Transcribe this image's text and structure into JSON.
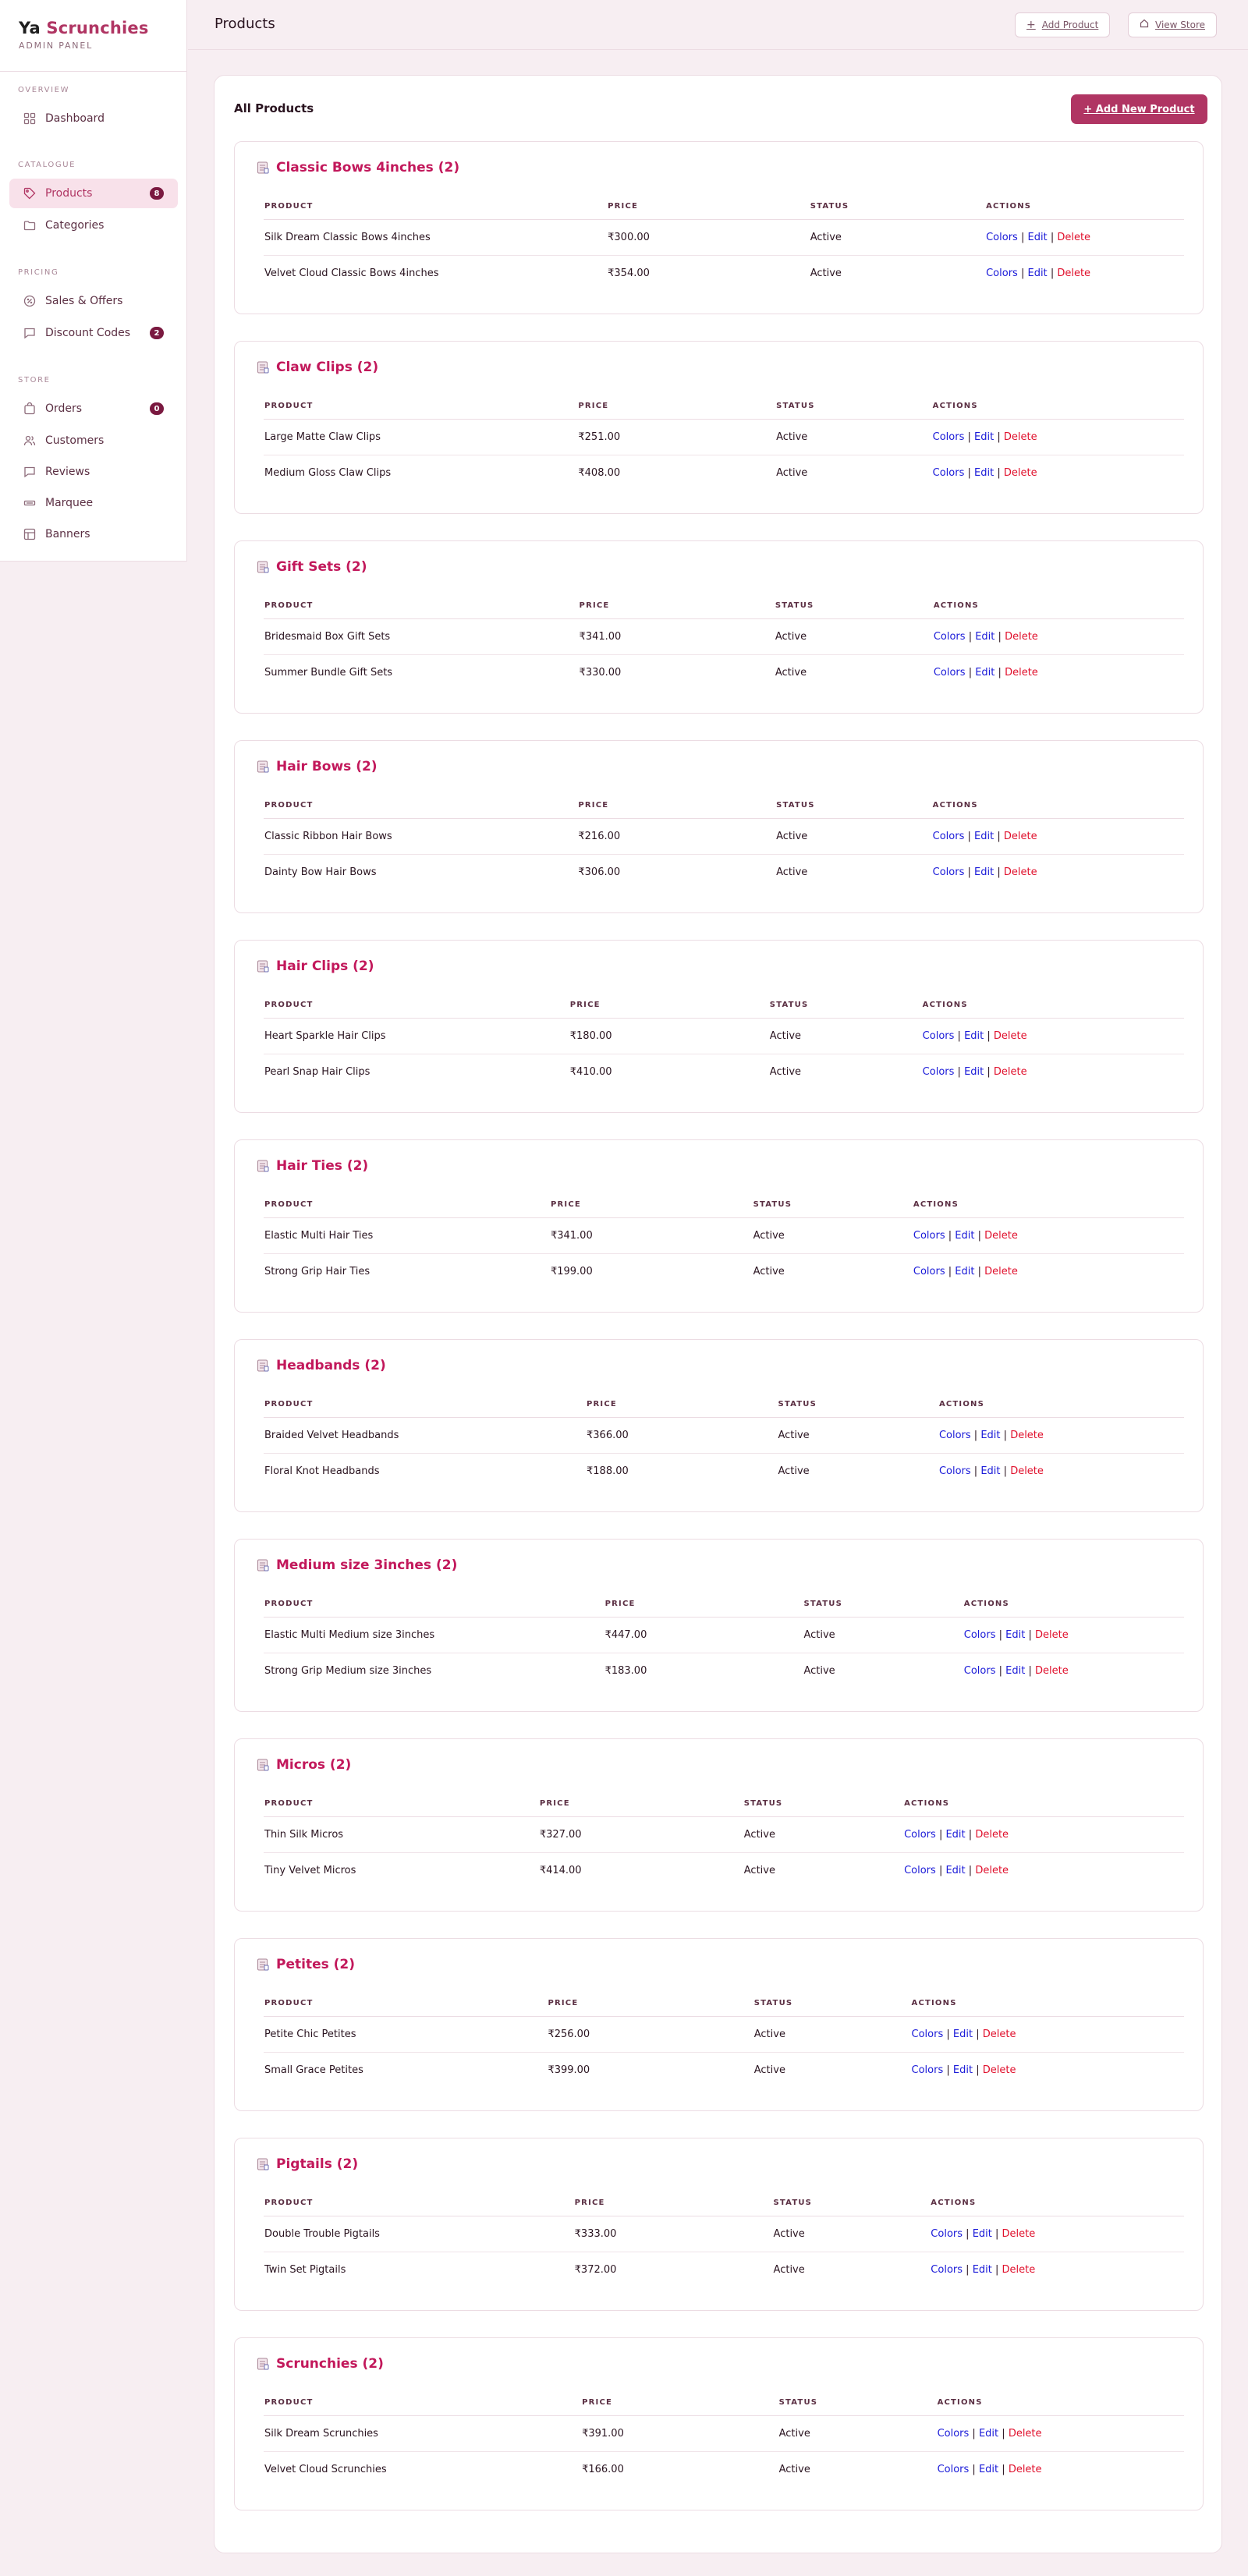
{
  "brand": {
    "name_part1": "Ya",
    "name_part2": "Scrunchies",
    "subtitle": "ADMIN PANEL"
  },
  "sidebar": {
    "sections": [
      {
        "label": "OVERVIEW",
        "items": [
          {
            "label": "Dashboard",
            "icon": "grid-icon"
          }
        ]
      },
      {
        "label": "CATALOGUE",
        "items": [
          {
            "label": "Products",
            "icon": "tag-icon",
            "badge": "8",
            "active": true
          },
          {
            "label": "Categories",
            "icon": "folder-icon"
          }
        ]
      },
      {
        "label": "PRICING",
        "items": [
          {
            "label": "Sales & Offers",
            "icon": "percent-icon"
          },
          {
            "label": "Discount Codes",
            "icon": "chat-icon",
            "badge": "2"
          }
        ]
      },
      {
        "label": "STORE",
        "items": [
          {
            "label": "Orders",
            "icon": "bag-icon",
            "badge": "0"
          },
          {
            "label": "Customers",
            "icon": "users-icon"
          },
          {
            "label": "Reviews",
            "icon": "message-icon"
          },
          {
            "label": "Marquee",
            "icon": "marquee-icon"
          },
          {
            "label": "Banners",
            "icon": "layout-icon"
          }
        ]
      }
    ]
  },
  "header": {
    "title": "Products",
    "add_product": "Add Product",
    "view_store": "View Store"
  },
  "panel": {
    "title": "All Products",
    "add_new": "+ Add New Product"
  },
  "table_headers": {
    "product": "PRODUCT",
    "price": "PRICE",
    "status": "STATUS",
    "actions": "ACTIONS"
  },
  "actions": {
    "colors": "Colors",
    "edit": "Edit",
    "delete": "Delete",
    "sep": "|"
  },
  "colors": {
    "accent": "#b03563",
    "category_title": "#c2185b",
    "link_blue": "#1a1ad8",
    "delete_red": "#e0102c"
  },
  "categories": [
    {
      "title": "Classic Bows 4inches (2)",
      "cols": [
        37.3,
        59.3,
        78.4
      ],
      "rows": [
        {
          "product": "Silk Dream Classic Bows 4inches",
          "price": "₹300.00",
          "status": "Active"
        },
        {
          "product": "Velvet Cloud Classic Bows 4inches",
          "price": "₹354.00",
          "status": "Active"
        }
      ]
    },
    {
      "title": "Claw Clips (2)",
      "cols": [
        34.1,
        55.6,
        72.6
      ],
      "rows": [
        {
          "product": "Large Matte Claw Clips",
          "price": "₹251.00",
          "status": "Active"
        },
        {
          "product": "Medium Gloss Claw Clips",
          "price": "₹408.00",
          "status": "Active"
        }
      ]
    },
    {
      "title": "Gift Sets (2)",
      "cols": [
        34.2,
        55.5,
        72.7
      ],
      "rows": [
        {
          "product": "Bridesmaid Box Gift Sets",
          "price": "₹341.00",
          "status": "Active"
        },
        {
          "product": "Summer Bundle Gift Sets",
          "price": "₹330.00",
          "status": "Active"
        }
      ]
    },
    {
      "title": "Hair Bows (2)",
      "cols": [
        34.1,
        55.6,
        72.6
      ],
      "rows": [
        {
          "product": "Classic Ribbon Hair Bows",
          "price": "₹216.00",
          "status": "Active"
        },
        {
          "product": "Dainty Bow Hair Bows",
          "price": "₹306.00",
          "status": "Active"
        }
      ]
    },
    {
      "title": "Hair Clips (2)",
      "cols": [
        33.2,
        54.9,
        71.5
      ],
      "rows": [
        {
          "product": "Heart Sparkle Hair Clips",
          "price": "₹180.00",
          "status": "Active"
        },
        {
          "product": "Pearl Snap Hair Clips",
          "price": "₹410.00",
          "status": "Active"
        }
      ]
    },
    {
      "title": "Hair Ties (2)",
      "cols": [
        31.1,
        53.1,
        70.5
      ],
      "rows": [
        {
          "product": "Elastic Multi Hair Ties",
          "price": "₹341.00",
          "status": "Active"
        },
        {
          "product": "Strong Grip Hair Ties",
          "price": "₹199.00",
          "status": "Active"
        }
      ]
    },
    {
      "title": "Headbands (2)",
      "cols": [
        35.0,
        55.8,
        73.3
      ],
      "rows": [
        {
          "product": "Braided Velvet Headbands",
          "price": "₹366.00",
          "status": "Active"
        },
        {
          "product": "Floral Knot Headbands",
          "price": "₹188.00",
          "status": "Active"
        }
      ]
    },
    {
      "title": "Medium size 3inches (2)",
      "cols": [
        37.0,
        58.6,
        76.0
      ],
      "rows": [
        {
          "product": "Elastic Multi Medium size 3inches",
          "price": "₹447.00",
          "status": "Active"
        },
        {
          "product": "Strong Grip Medium size 3inches",
          "price": "₹183.00",
          "status": "Active"
        }
      ]
    },
    {
      "title": "Micros (2)",
      "cols": [
        29.9,
        52.1,
        69.5
      ],
      "rows": [
        {
          "product": "Thin Silk Micros",
          "price": "₹327.00",
          "status": "Active"
        },
        {
          "product": "Tiny Velvet Micros",
          "price": "₹414.00",
          "status": "Active"
        }
      ]
    },
    {
      "title": "Petites (2)",
      "cols": [
        30.8,
        53.2,
        70.3
      ],
      "rows": [
        {
          "product": "Petite Chic Petites",
          "price": "₹256.00",
          "status": "Active"
        },
        {
          "product": "Small Grace Petites",
          "price": "₹399.00",
          "status": "Active"
        }
      ]
    },
    {
      "title": "Pigtails (2)",
      "cols": [
        33.7,
        55.3,
        72.4
      ],
      "rows": [
        {
          "product": "Double Trouble Pigtails",
          "price": "₹333.00",
          "status": "Active"
        },
        {
          "product": "Twin Set Pigtails",
          "price": "₹372.00",
          "status": "Active"
        }
      ]
    },
    {
      "title": "Scrunchies (2)",
      "cols": [
        34.5,
        55.9,
        73.1
      ],
      "rows": [
        {
          "product": "Silk Dream Scrunchies",
          "price": "₹391.00",
          "status": "Active"
        },
        {
          "product": "Velvet Cloud Scrunchies",
          "price": "₹166.00",
          "status": "Active"
        }
      ]
    }
  ]
}
